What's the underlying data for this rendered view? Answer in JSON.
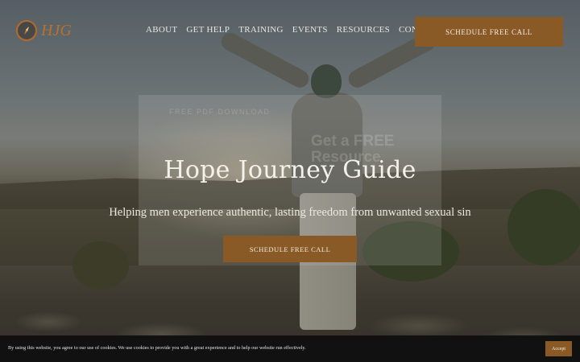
{
  "header": {
    "logo_text": "HJG",
    "nav": [
      "ABOUT",
      "GET HELP",
      "TRAINING",
      "EVENTS",
      "RESOURCES",
      "CONTACT"
    ],
    "cta_label": "SCHEDULE FREE CALL"
  },
  "popup": {
    "kicker": "FREE PDF DOWNLOAD",
    "title": "Get a FREE Resource"
  },
  "hero": {
    "title": "Hope Journey Guide",
    "subtitle": "Helping men experience authentic, lasting freedom from unwanted sexual sin",
    "cta_label": "SCHEDULE FREE CALL"
  },
  "cookie": {
    "text": "By using this website, you agree to our use of cookies. We use cookies to provide you with a great experience and to help our website run effectively.",
    "accept_label": "Accept"
  },
  "colors": {
    "accent": "#8a5a26",
    "logo": "#b9722e",
    "cookie_bar": "#111111"
  },
  "icons": {
    "logo": "compass-icon"
  }
}
